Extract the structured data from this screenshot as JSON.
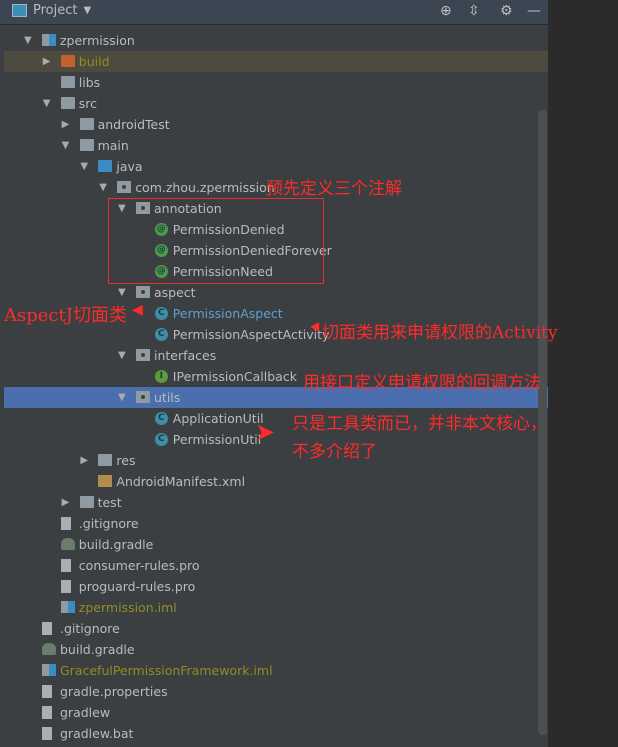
{
  "header": {
    "title": "Project",
    "icons": [
      "crosshair-icon",
      "collapse-icon",
      "gear-icon",
      "minimize-icon"
    ]
  },
  "tree": [
    {
      "label": "zpermission",
      "level": 0,
      "arrow": "down",
      "icon": "mod"
    },
    {
      "label": "build",
      "level": 1,
      "arrow": "right",
      "icon": "folder orange",
      "style": "olive",
      "row": "hl"
    },
    {
      "label": "libs",
      "level": 1,
      "icon": "folder"
    },
    {
      "label": "src",
      "level": 1,
      "arrow": "down",
      "icon": "folder"
    },
    {
      "label": "androidTest",
      "level": 2,
      "arrow": "right",
      "icon": "folder"
    },
    {
      "label": "main",
      "level": 2,
      "arrow": "down",
      "icon": "folder"
    },
    {
      "label": "java",
      "level": 3,
      "arrow": "down",
      "icon": "folder blue"
    },
    {
      "label": "com.zhou.zpermission",
      "level": 4,
      "arrow": "down",
      "icon": "pkg"
    },
    {
      "label": "annotation",
      "level": 5,
      "arrow": "down",
      "icon": "pkg"
    },
    {
      "label": "PermissionDenied",
      "level": 6,
      "icon": "circ ann",
      "glyph": "@"
    },
    {
      "label": "PermissionDeniedForever",
      "level": 6,
      "icon": "circ ann",
      "glyph": "@"
    },
    {
      "label": "PermissionNeed",
      "level": 6,
      "icon": "circ ann",
      "glyph": "@"
    },
    {
      "label": "aspect",
      "level": 5,
      "arrow": "down",
      "icon": "pkg"
    },
    {
      "label": "PermissionAspect",
      "level": 6,
      "icon": "circ cls",
      "glyph": "C",
      "style": "bluet"
    },
    {
      "label": "PermissionAspectActivity",
      "level": 6,
      "icon": "circ cls",
      "glyph": "C"
    },
    {
      "label": "interfaces",
      "level": 5,
      "arrow": "down",
      "icon": "pkg"
    },
    {
      "label": "IPermissionCallback",
      "level": 6,
      "icon": "circ itf",
      "glyph": "I"
    },
    {
      "label": "utils",
      "level": 5,
      "arrow": "down",
      "icon": "pkg",
      "row": "sel"
    },
    {
      "label": "ApplicationUtil",
      "level": 6,
      "icon": "circ cls",
      "glyph": "C"
    },
    {
      "label": "PermissionUtil",
      "level": 6,
      "icon": "circ cls",
      "glyph": "C"
    },
    {
      "label": "res",
      "level": 3,
      "arrow": "right",
      "icon": "folder"
    },
    {
      "label": "AndroidManifest.xml",
      "level": 3,
      "icon": "xml"
    },
    {
      "label": "test",
      "level": 2,
      "arrow": "right",
      "icon": "folder"
    },
    {
      "label": ".gitignore",
      "level": 1,
      "icon": "file"
    },
    {
      "label": "build.gradle",
      "level": 1,
      "icon": "gradle"
    },
    {
      "label": "consumer-rules.pro",
      "level": 1,
      "icon": "file"
    },
    {
      "label": "proguard-rules.pro",
      "level": 1,
      "icon": "file"
    },
    {
      "label": "zpermission.iml",
      "level": 1,
      "icon": "mod",
      "style": "olive"
    },
    {
      "label": ".gitignore",
      "level": 0,
      "icon": "file"
    },
    {
      "label": "build.gradle",
      "level": 0,
      "icon": "gradle"
    },
    {
      "label": "GracefulPermissionFramework.iml",
      "level": 0,
      "icon": "mod",
      "style": "olive"
    },
    {
      "label": "gradle.properties",
      "level": 0,
      "icon": "file"
    },
    {
      "label": "gradlew",
      "level": 0,
      "icon": "file"
    },
    {
      "label": "gradlew.bat",
      "level": 0,
      "icon": "file"
    }
  ],
  "annotations": {
    "predefined": "预先定义三个注解",
    "aspectj": "AspectJ切面类",
    "activity": "切面类用来申请权限的Activity",
    "callback": "用接口定义申请权限的回调方法",
    "utils_line1": "只是工具类而已，并非本文核心，",
    "utils_line2": "不多介绍了"
  },
  "colors": {
    "annotation": "#ff2a2a",
    "selection": "#4b6eaf"
  }
}
